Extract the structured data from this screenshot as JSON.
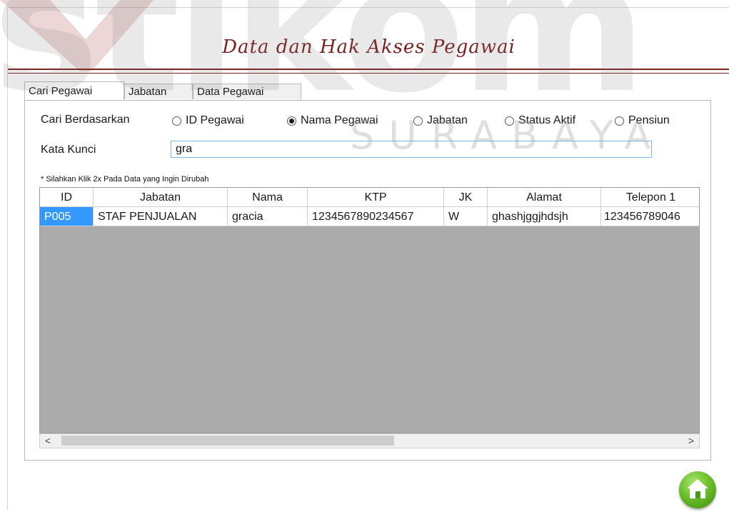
{
  "watermark": {
    "logo_text": "stikom",
    "sub_text": "SURABAYA"
  },
  "header": {
    "title": "Data dan Hak Akses Pegawai"
  },
  "tabs": [
    {
      "label": "Cari Pegawai",
      "active": true
    },
    {
      "label": "Jabatan",
      "active": false
    },
    {
      "label": "Data Pegawai",
      "active": false
    }
  ],
  "search": {
    "by_label": "Cari Berdasarkan",
    "options": [
      {
        "label": "ID Pegawai",
        "selected": false
      },
      {
        "label": "Nama Pegawai",
        "selected": true
      },
      {
        "label": "Jabatan",
        "selected": false
      },
      {
        "label": "Status Aktif",
        "selected": false
      },
      {
        "label": "Pensiun",
        "selected": false
      }
    ],
    "keyword_label": "Kata Kunci",
    "keyword_value": "gra"
  },
  "note": "* Silahkan Klik 2x Pada Data yang Ingin Dirubah",
  "grid": {
    "columns": [
      "ID",
      "Jabatan",
      "Nama",
      "KTP",
      "JK",
      "Alamat",
      "Telepon 1"
    ],
    "rows": [
      [
        "P005",
        "STAF PENJUALAN",
        "gracia",
        "1234567890234567",
        "W",
        "ghashjggjhdsjh",
        "123456789046"
      ]
    ]
  },
  "scrollbar": {
    "left_arrow": "<",
    "right_arrow": ">"
  },
  "home_button": {
    "icon": "home-icon"
  },
  "colors": {
    "accent": "#7b2020",
    "selection": "#3399ff",
    "grid_empty": "#ababab",
    "input_border": "#7ab3dc"
  }
}
